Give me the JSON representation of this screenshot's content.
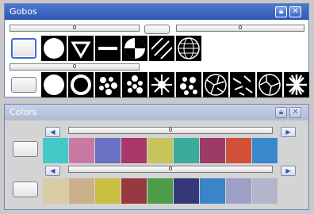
{
  "gobos": {
    "title": "Gobos",
    "bar_left": "0",
    "bar_right": "0",
    "bar_row2": "0",
    "row1_gobos": [
      "open-circle",
      "triangle",
      "bar",
      "split-quadrants",
      "stripes",
      "grid-sphere"
    ],
    "row2_gobos": [
      "open-circle-2",
      "ring",
      "dots-cluster",
      "dots-cluster-2",
      "radial-burst",
      "dots-cluster-3",
      "cracks",
      "shards",
      "cracks-2",
      "scatter",
      "radial-burst-2"
    ]
  },
  "colors": {
    "title": "Colors",
    "bar1": "0",
    "bar2": "0",
    "row1": [
      "#44c8c8",
      "#c87aa4",
      "#6a70c4",
      "#a8386a",
      "#c8c45c",
      "#3aac9c",
      "#9c3c64",
      "#d0503a",
      "#3a88cc"
    ],
    "row2": [
      "#d8cca4",
      "#ccb08c",
      "#c8c040",
      "#983840",
      "#4c9c48",
      "#343878",
      "#3c84c8",
      "#9ca0c4",
      "#b4b4cc"
    ]
  }
}
